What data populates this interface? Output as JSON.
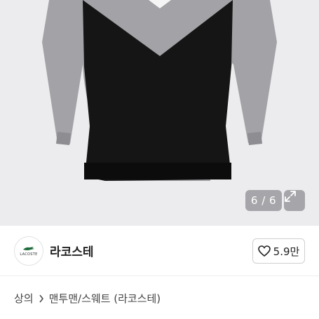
{
  "gallery": {
    "counter": "6 / 6"
  },
  "brand": {
    "logo_text": "LACOSTE",
    "name": "라코스테",
    "like_count": "5.9만"
  },
  "breadcrumb": {
    "items": [
      "상의",
      "맨투맨/스웨트 (라코스테)"
    ]
  },
  "product": {
    "title_partial": ""
  },
  "colors": {
    "photo_bg": "#ececee",
    "sweater_gray": "#9d9da1",
    "sweater_black": "#141414"
  }
}
